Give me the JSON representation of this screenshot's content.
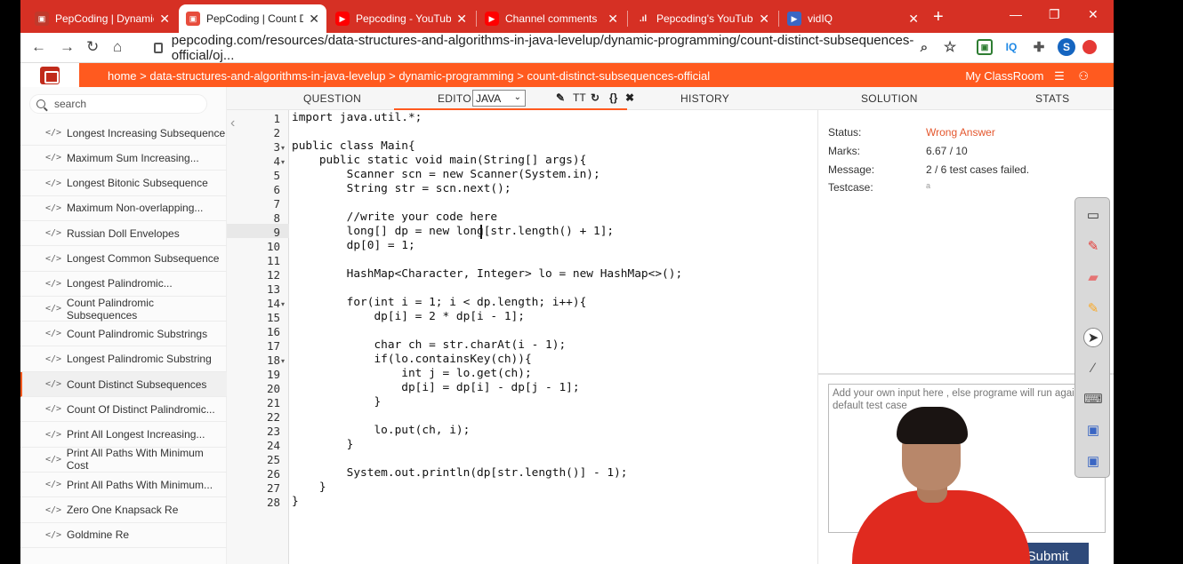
{
  "browser": {
    "tabs": [
      {
        "title": "PepCoding | Dynamic",
        "icon": "pepcoding-favicon",
        "active": false
      },
      {
        "title": "PepCoding | Count D",
        "icon": "pepcoding-favicon",
        "active": true
      },
      {
        "title": "Pepcoding - YouTube",
        "icon": "youtube-favicon",
        "active": false
      },
      {
        "title": "Channel comments",
        "icon": "youtube-favicon",
        "active": false
      },
      {
        "title": "Pepcoding's YouTube",
        "icon": "studio-bars-favicon",
        "active": false
      },
      {
        "title": "vidIQ",
        "icon": "vidiq-favicon",
        "active": false
      }
    ],
    "url": "pepcoding.com/resources/data-structures-and-algorithms-in-java-levelup/dynamic-programming/count-distinct-subsequences-official/oj...",
    "profile_initial": "S",
    "extension_iq": "IQ"
  },
  "header": {
    "breadcrumb": "home > data-structures-and-algorithms-in-java-levelup > dynamic-programming > count-distinct-subsequences-official",
    "classroom": "My ClassRoom"
  },
  "sidebar": {
    "search_placeholder": "search",
    "code_icon": "</>",
    "items": [
      "Longest Increasing Subsequence",
      "Maximum Sum Increasing...",
      "Longest Bitonic Subsequence",
      "Maximum Non-overlapping...",
      "Russian Doll Envelopes",
      "Longest Common Subsequence",
      "Longest Palindromic...",
      "Count Palindromic Subsequences",
      "Count Palindromic Substrings",
      "Longest Palindromic Substring",
      "Count Distinct Subsequences",
      "Count Of Distinct Palindromic...",
      "Print All Longest Increasing...",
      "Print All Paths With Minimum Cost",
      "Print All Paths With Minimum...",
      "Zero One Knapsack Re",
      "Goldmine Re"
    ],
    "active_index": 10
  },
  "editor_tabs": {
    "question": "QUESTION",
    "editor": "EDITOR",
    "language": "JAVA",
    "history": "HISTORY",
    "solution": "SOLUTION",
    "stats": "STATS"
  },
  "code": {
    "line_numbers": [
      "1",
      "2",
      "3",
      "4",
      "5",
      "6",
      "7",
      "8",
      "9",
      "10",
      "11",
      "12",
      "13",
      "14",
      "15",
      "16",
      "17",
      "18",
      "19",
      "20",
      "21",
      "22",
      "23",
      "24",
      "25",
      "26",
      "27",
      "28"
    ],
    "lines": [
      "import java.util.*;",
      "",
      "public class Main{",
      "    public static void main(String[] args){",
      "        Scanner scn = new Scanner(System.in);",
      "        String str = scn.next();",
      "",
      "        //write your code here",
      "        long[] dp = new long[str.length() + 1];",
      "        dp[0] = 1;",
      "",
      "        HashMap<Character, Integer> lo = new HashMap<>();",
      "",
      "        for(int i = 1; i < dp.length; i++){",
      "            dp[i] = 2 * dp[i - 1];",
      "",
      "            char ch = str.charAt(i - 1);",
      "            if(lo.containsKey(ch)){",
      "                int j = lo.get(ch);",
      "                dp[i] = dp[i] - dp[j - 1];",
      "            }",
      "",
      "            lo.put(ch, i);",
      "        }",
      "",
      "        System.out.println(dp[str.length()] - 1);",
      "    }",
      "}"
    ]
  },
  "result": {
    "status_label": "Status:",
    "status_value": "Wrong Answer",
    "marks_label": "Marks:",
    "marks_value": "6.67 / 10",
    "message_label": "Message:",
    "message_value": "2 / 6 test cases failed.",
    "testcase_label": "Testcase:",
    "testcase_value": "a",
    "custom_input_placeholder": "Add your own input here , else programe will run against default test case",
    "submit_label": "Submit",
    "status_color": "#e4572e"
  },
  "colors": {
    "brand_orange": "#ff5a1f",
    "tab_strip_red": "#d63024",
    "submit_blue": "#2f4a7a"
  }
}
